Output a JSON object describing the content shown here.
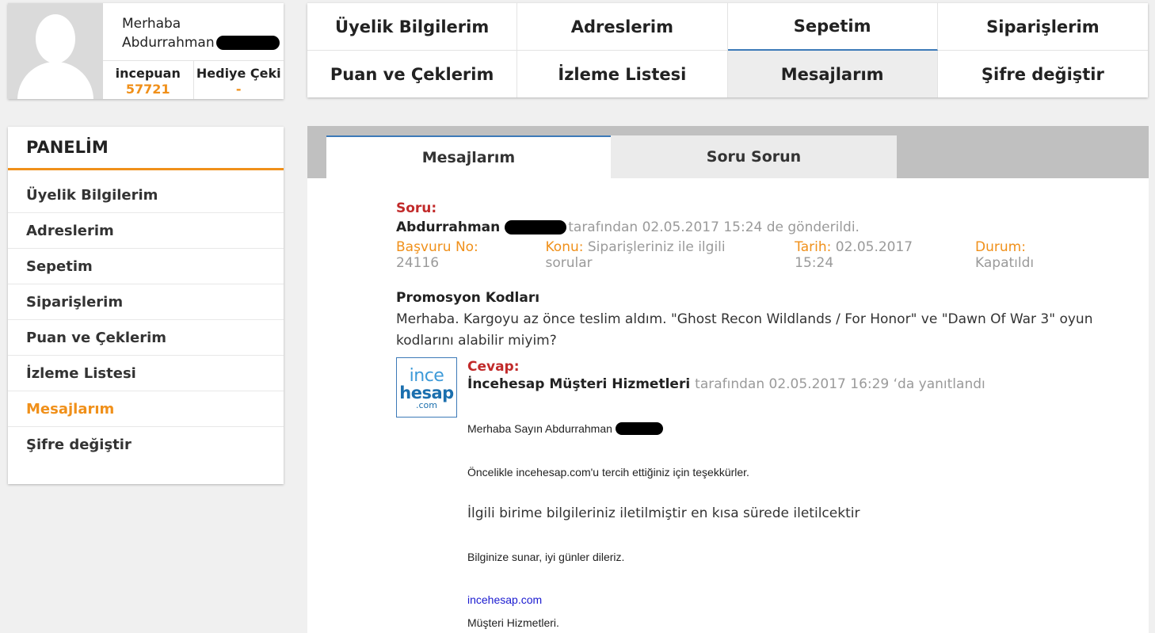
{
  "profile": {
    "greeting": "Merhaba",
    "name": "Abdurrahman",
    "stats": [
      {
        "label": "incepuan",
        "value": "57721"
      },
      {
        "label": "Hediye Çeki",
        "value": "-"
      }
    ]
  },
  "topnav": [
    "Üyelik Bilgilerim",
    "Adreslerim",
    "Sepetim",
    "Siparişlerim",
    "Puan ve Çeklerim",
    "İzleme Listesi",
    "Mesajlarım",
    "Şifre değiştir"
  ],
  "sidebar": {
    "title": "PANELİM",
    "items": [
      "Üyelik Bilgilerim",
      "Adreslerim",
      "Sepetim",
      "Siparişlerim",
      "Puan ve Çeklerim",
      "İzleme Listesi",
      "Mesajlarım",
      "Şifre değiştir"
    ],
    "active": "Mesajlarım"
  },
  "tabs": [
    "Mesajlarım",
    "Soru Sorun"
  ],
  "question": {
    "label": "Soru:",
    "author": "Abdurrahman",
    "sent_text": "tarafından 02.05.2017 15:24 de gönderildi.",
    "meta": [
      {
        "key": "Başvuru No:",
        "value": "24116"
      },
      {
        "key": "Konu:",
        "value": "Siparişleriniz ile ilgili sorular"
      },
      {
        "key": "Tarih:",
        "value": "02.05.2017 15:24"
      },
      {
        "key": "Durum:",
        "value": "Kapatıldı"
      }
    ],
    "subject": "Promosyon Kodları",
    "body": "Merhaba. Kargoyu az önce teslim aldım. \"Ghost Recon Wildlands / For Honor\" ve \"Dawn Of War 3\" oyun kodlarını alabilir miyim?"
  },
  "answer": {
    "logo": {
      "line1": "ince",
      "line2": "hesap",
      "line3": ".com"
    },
    "label": "Cevap:",
    "author": "İncehesap Müşteri Hizmetleri",
    "replied_text": "tarafından 02.05.2017 16:29 ‘da yanıtlandı",
    "lines": [
      "Merhaba Sayın Abdurrahman",
      "Öncelikle incehesap.com'u tercih ettiğiniz için teşekkürler.",
      "İlgili birime bilgileriniz iletilmiştir en kısa sürede iletilcektir",
      "Bilginize sunar, iyi günler dileriz.",
      "incehesap.com",
      "Müşteri Hizmetleri."
    ]
  },
  "colors": {
    "accent": "#f0901a",
    "link": "#3d7ab8",
    "danger": "#c12a2a"
  }
}
